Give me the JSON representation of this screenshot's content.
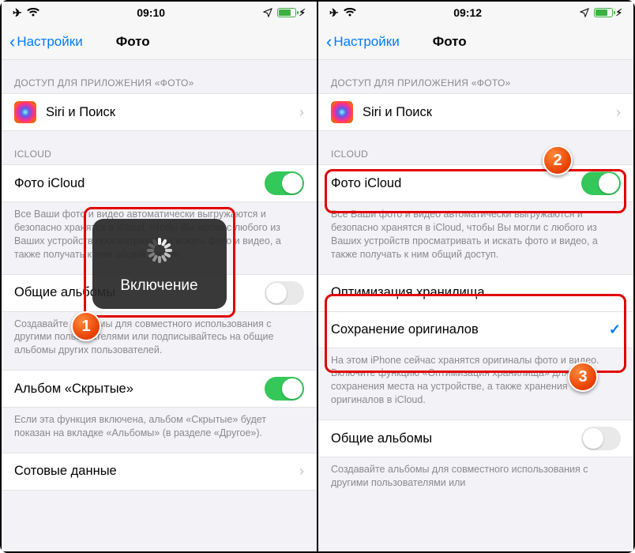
{
  "left": {
    "status": {
      "time": "09:10"
    },
    "nav": {
      "back": "Настройки",
      "title": "Фото"
    },
    "sec_access_hdr": "ДОСТУП ДЛЯ ПРИЛОЖЕНИЯ «ФОТО»",
    "siri_label": "Siri и Поиск",
    "sec_icloud_hdr": "ICLOUD",
    "icloud_photos_label": "Фото iCloud",
    "icloud_footer": "Все Ваши фото и видео автоматически выгружаются и безопасно хранятся в iCloud, чтобы Вы могли с любого из Ваших устройств просматривать и искать фото и видео, а также получать к ним общий доступ.",
    "shared_label": "Общие альбомы",
    "shared_footer": "Создавайте альбомы для совместного использования с другими пользователями или подписывайтесь на общие альбомы других пользователей.",
    "hidden_label": "Альбом «Скрытые»",
    "hidden_footer": "Если эта функция включена, альбом «Скрытые» будет показан на вкладке «Альбомы» (в разделе «Другое»).",
    "cellular_label": "Сотовые данные",
    "toast_text": "Включение",
    "callout1": "1"
  },
  "right": {
    "status": {
      "time": "09:12"
    },
    "nav": {
      "back": "Настройки",
      "title": "Фото"
    },
    "sec_access_hdr": "ДОСТУП ДЛЯ ПРИЛОЖЕНИЯ «ФОТО»",
    "siri_label": "Siri и Поиск",
    "sec_icloud_hdr": "ICLOUD",
    "icloud_photos_label": "Фото iCloud",
    "icloud_footer": "Все Ваши фото и видео автоматически выгружаются и безопасно хранятся в iCloud, чтобы Вы могли с любого из Ваших устройств просматривать и искать фото и видео, а также получать к ним общий доступ.",
    "optimize_label": "Оптимизация хранилища",
    "originals_label": "Сохранение оригиналов",
    "storage_footer": "На этом iPhone сейчас хранятся оригиналы фото и видео. Включите функцию «Оптимизация хранилища» для сохранения места на устройстве, а также хранения оригиналов в iCloud.",
    "shared_label": "Общие альбомы",
    "shared_footer": "Создавайте альбомы для совместного использования с другими пользователями или",
    "callout2": "2",
    "callout3": "3"
  }
}
